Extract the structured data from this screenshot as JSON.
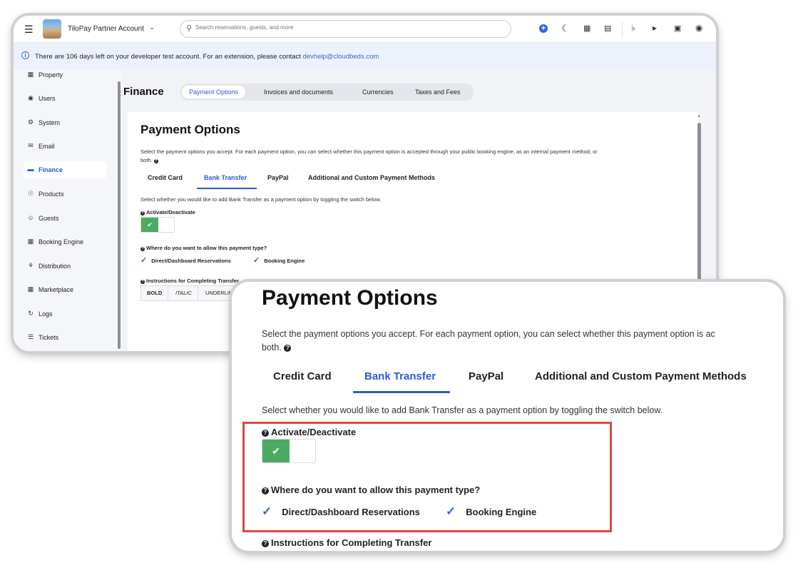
{
  "topbar": {
    "account_name": "TiloPay Partner Account",
    "search_placeholder": "Search reservations, guests, and more"
  },
  "banner": {
    "text": "There are 106 days left on your developer test account. For an extension, please contact",
    "email": "devhelp@cloudbeds.com"
  },
  "sidebar": {
    "items": [
      {
        "label": "Property",
        "icon": "property-icon"
      },
      {
        "label": "Users",
        "icon": "user-icon"
      },
      {
        "label": "System",
        "icon": "gear-icon"
      },
      {
        "label": "Email",
        "icon": "envelope-icon"
      },
      {
        "label": "Finance",
        "icon": "credit-card-icon",
        "active": true
      },
      {
        "label": "Products",
        "icon": "cart-icon"
      },
      {
        "label": "Guests",
        "icon": "guest-icon"
      },
      {
        "label": "Booking Engine",
        "icon": "calendar-icon"
      },
      {
        "label": "Distribution",
        "icon": "network-icon"
      },
      {
        "label": "Marketplace",
        "icon": "grid-icon"
      },
      {
        "label": "Logs",
        "icon": "history-icon"
      },
      {
        "label": "Tickets",
        "icon": "list-icon"
      }
    ]
  },
  "finance": {
    "title": "Finance",
    "tabs": [
      "Payment Options",
      "Invoices and documents",
      "Currencies",
      "Taxes and Fees"
    ],
    "active_tab": "Payment Options"
  },
  "payment": {
    "title": "Payment Options",
    "desc_line1": "Select the payment options you accept. For each payment option, you can select whether this payment option is accepted through your public booking engine, as an internal payment method, or",
    "desc_line2": "both.",
    "tabs": [
      "Credit Card",
      "Bank Transfer",
      "PayPal",
      "Additional and Custom Payment Methods"
    ],
    "active_tab": "Bank Transfer",
    "select_text": "Select whether you would like to add Bank Transfer as a payment option by toggling the switch below.",
    "activate_label": "Activate/Deactivate",
    "toggle_state": "on",
    "where_label": "Where do you want to allow this payment type?",
    "check_direct": "Direct/Dashboard Reservations",
    "check_booking": "Booking Engine",
    "instructions_label": "Instructions for Completing Transfer",
    "toolbar": {
      "bold": "BOLD",
      "italic": "ITALIC",
      "underline": "UNDERLIN"
    }
  },
  "zoom": {
    "desc_line1": "Select the payment options you accept. For each payment option, you can select whether this payment option is ac",
    "desc_line2": "both."
  },
  "colors": {
    "accent": "#2d5ad0",
    "toggle_on": "#4caa63",
    "highlight": "#d94a46"
  }
}
